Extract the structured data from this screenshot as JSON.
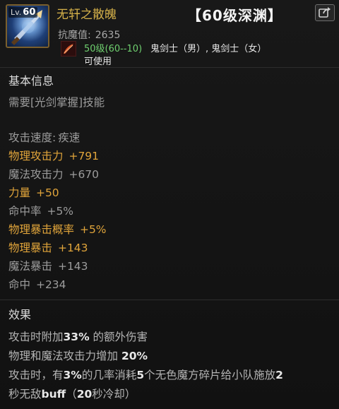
{
  "header": {
    "level_prefix": "Lv.",
    "level": "60",
    "item_name": "无轩之散魄",
    "tag": "【60级深渊】",
    "resist_label": "抗魔值:",
    "resist_value": "2635",
    "req_level": "50级(60--10)",
    "req_class": "鬼剑士（男）, 鬼剑士（女）",
    "usable": "可使用"
  },
  "basic": {
    "title": "基本信息",
    "skill_req": "需要[光剑掌握]技能",
    "stats": [
      {
        "label": "攻击速度:",
        "value": "疾速"
      },
      {
        "label": "物理攻击力",
        "value": "+791"
      },
      {
        "label": "魔法攻击力",
        "value": "+670"
      },
      {
        "label": "力量",
        "value": "+50"
      },
      {
        "label": "命中率",
        "value": "+5%"
      },
      {
        "label": "物理暴击概率",
        "value": "+5%"
      },
      {
        "label": "物理暴击",
        "value": "+143"
      },
      {
        "label": "魔法暴击",
        "value": "+143"
      },
      {
        "label": "命中",
        "value": "+234"
      }
    ]
  },
  "effect": {
    "title": "效果",
    "line1": {
      "a": "攻击时附加",
      "b": "33%",
      "c": " 的额外伤害"
    },
    "line2": {
      "a": "物理和魔法攻击力增加 ",
      "b": "20%"
    },
    "line3": {
      "a": "攻击时，有",
      "b": "3%",
      "c": "的几率消耗",
      "d": "5",
      "e": "个无色魔方碎片给小队施放",
      "f": "2"
    },
    "line4": {
      "a": "秒无敌",
      "b": "buff",
      "c": "（",
      "d": "20",
      "e": "秒冷却）"
    }
  },
  "colors": {
    "item_name": "#d4b049",
    "highlight_stat": "#e0a43a",
    "normal_stat": "#9c9c9c",
    "req_level": "#6fd06f"
  },
  "icons": {
    "item_icon": "sword-portrait-icon",
    "weapon_type_icon": "feather-wing-icon",
    "share_icon": "share-arrow-icon"
  }
}
